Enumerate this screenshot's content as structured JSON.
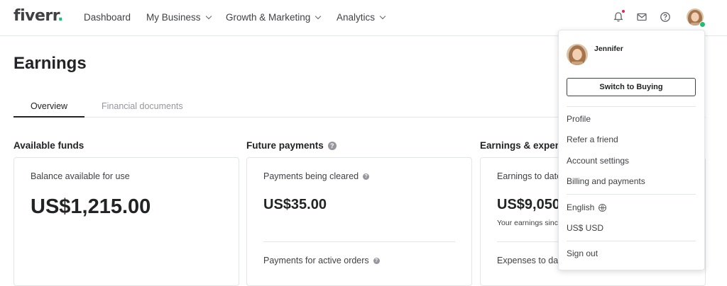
{
  "brand": {
    "logo_text": "fiverr",
    "logo_dot": ".",
    "accent": "#1dbf73"
  },
  "nav": {
    "items": [
      {
        "label": "Dashboard"
      },
      {
        "label": "My Business"
      },
      {
        "label": "Growth & Marketing"
      },
      {
        "label": "Analytics"
      }
    ],
    "icons": [
      "bell-icon",
      "envelope-icon",
      "help-icon",
      "avatar"
    ],
    "notification_color": "#e0245e"
  },
  "page": {
    "title": "Earnings",
    "tabs": [
      {
        "label": "Overview",
        "active": true
      },
      {
        "label": "Financial documents",
        "active": false
      }
    ]
  },
  "sections": {
    "available": {
      "title": "Available funds",
      "label": "Balance available for use",
      "amount": "US$1,215.00"
    },
    "future": {
      "title": "Future payments",
      "label": "Payments being cleared",
      "amount": "US$35.00",
      "label2": "Payments for active orders"
    },
    "earnings": {
      "title": "Earnings & expen",
      "label": "Earnings to date",
      "amount": "US$9,050",
      "sub": "Your earnings sinc",
      "label2": "Expenses to da"
    }
  },
  "dropdown": {
    "user_name": "Jennifer",
    "switch_label": "Switch to Buying",
    "items": [
      {
        "label": "Profile"
      },
      {
        "label": "Refer a friend"
      },
      {
        "label": "Account settings"
      },
      {
        "label": "Billing and payments"
      }
    ],
    "language": "English",
    "currency": "US$ USD",
    "sign_out": "Sign out"
  }
}
